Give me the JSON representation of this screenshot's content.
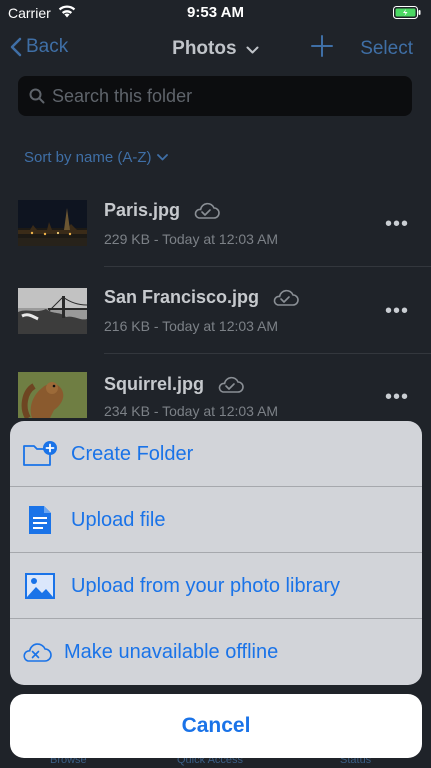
{
  "status_bar": {
    "carrier": "Carrier",
    "time": "9:53 AM"
  },
  "nav": {
    "back_label": "Back",
    "title": "Photos",
    "select_label": "Select"
  },
  "search": {
    "placeholder": "Search this folder"
  },
  "sort": {
    "label": "Sort by name (A-Z)"
  },
  "files": [
    {
      "name": "Paris.jpg",
      "meta": "229 KB - Today at 12:03 AM"
    },
    {
      "name": "San Francisco.jpg",
      "meta": "216 KB - Today at 12:03 AM"
    },
    {
      "name": "Squirrel.jpg",
      "meta": "234 KB - Today at 12:03 AM"
    }
  ],
  "tabs": [
    "Browse",
    "Quick Access",
    "Status"
  ],
  "action_sheet": {
    "actions": [
      {
        "label": "Create Folder",
        "icon": "folder-plus-icon"
      },
      {
        "label": "Upload file",
        "icon": "document-icon"
      },
      {
        "label": "Upload from your photo library",
        "icon": "photo-icon"
      },
      {
        "label": "Make unavailable offline",
        "icon": "cloud-x-icon"
      }
    ],
    "cancel_label": "Cancel"
  },
  "colors": {
    "accent": "#1a73e8",
    "dim_accent": "#3f6fa6",
    "background": "#1f2329",
    "sheet": "#d2d4d9"
  }
}
